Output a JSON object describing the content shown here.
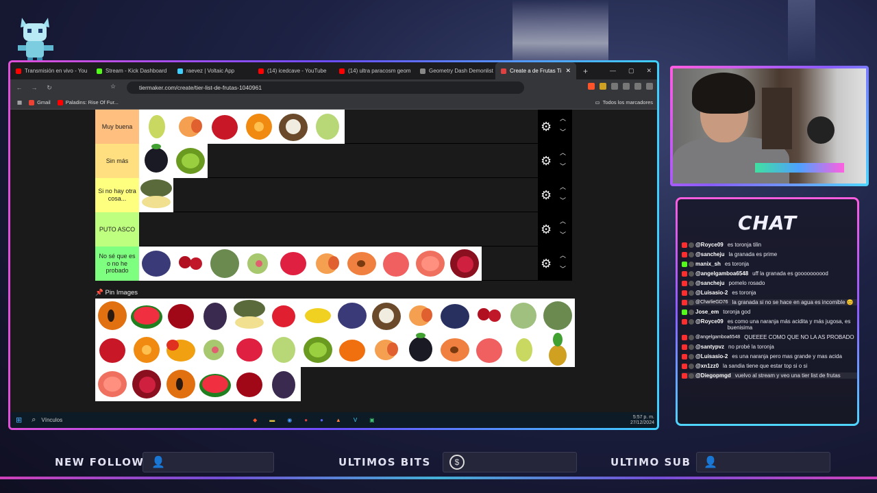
{
  "browser": {
    "tabs": [
      {
        "label": "Transmisión en vivo - You",
        "color": "#ff0000"
      },
      {
        "label": "Stream - Kick Dashboard",
        "color": "#53fc18"
      },
      {
        "label": "raevez | Voltaic App",
        "color": "#3fd0ff"
      },
      {
        "label": "(14) icedcave - YouTube",
        "color": "#ff0000"
      },
      {
        "label": "(14) ultra paracosm geom",
        "color": "#ff0000"
      },
      {
        "label": "Geometry Dash Demonlist",
        "color": "#888888"
      },
      {
        "label": "Create a de Frutas Ti",
        "color": "#e04040",
        "active": true
      }
    ],
    "new_tab": "+",
    "window_controls": [
      "—",
      "▢",
      "✕"
    ],
    "url": "tiermaker.com/create/tier-list-de-frutas-1040961",
    "bookmarks": {
      "gmail": "Gmail",
      "paladins": "Paladins: Rise Of Fur...",
      "all": "Todos los marcadores"
    }
  },
  "tierlist": {
    "tiers": [
      {
        "label": "Muy buena",
        "color": "#ffbf7f",
        "items": [
          "pear",
          "peach",
          "apple",
          "orange",
          "coconut",
          "grapes"
        ]
      },
      {
        "label": "Sin más",
        "color": "#ffdf7f",
        "items": [
          "blackberry",
          "kiwi"
        ]
      },
      {
        "label": "Si no hay otra cosa...",
        "color": "#ffff7f",
        "items": [
          "melon"
        ]
      },
      {
        "label": "PUTO ASCO",
        "color": "#bfff7f",
        "items": []
      },
      {
        "label": "No sé que es o no he probado",
        "color": "#7fff7f",
        "items": [
          "plum",
          "cherry",
          "feijoa",
          "fig",
          "raspberry",
          "peach",
          "apricot",
          "nectarine",
          "grapefruit",
          "pomegranate"
        ]
      }
    ],
    "pin_label": "Pin Images",
    "pool": [
      "papaya",
      "watermelon",
      "redapple",
      "blackgrape",
      "melon",
      "strawberry",
      "banana",
      "plum",
      "coconut",
      "peach",
      "blueberry",
      "cherry",
      "custard",
      "feijoa",
      "apple",
      "orange",
      "mango",
      "fig",
      "raspberry",
      "grapes",
      "kiwi",
      "tangerine",
      "peach",
      "blackberry",
      "apricot",
      "nectarine",
      "pear",
      "pineapple",
      "grapefruit",
      "pomegranate",
      "papaya",
      "watermelon",
      "redapple",
      "blackgrape"
    ]
  },
  "taskbar": {
    "search": "Vínculos",
    "time": "5:57 p. m.",
    "date": "27/12/2024"
  },
  "chat": {
    "title": "CHAT",
    "messages": [
      {
        "user": "@Royce09",
        "text": "es toronja tilin",
        "icon": "#ff2d2d"
      },
      {
        "user": "@sancheju",
        "text": "la granada es prime",
        "icon": "#ff2d2d"
      },
      {
        "user": "manix_sh",
        "text": "es toronja",
        "icon": "#53fc18"
      },
      {
        "user": "@angelgamboa6548",
        "text": "uff la granada es goooooooood",
        "icon": "#ff2d2d"
      },
      {
        "user": "@sancheju",
        "text": "pomelo rosado",
        "icon": "#ff2d2d"
      },
      {
        "user": "@Luisasio-2",
        "text": "es toronja",
        "icon": "#ff2d2d"
      },
      {
        "user": "@CharlieGD76",
        "text": "la granada si no se hace en agua es incomible 😊",
        "icon": "#ff2d2d",
        "small": true,
        "hl": true
      },
      {
        "user": "Jose_em",
        "text": "toronja god",
        "icon": "#53fc18"
      },
      {
        "user": "@Royce09",
        "text": "es como una naranja más acidita y más jugosa, es buenisima",
        "icon": "#ff2d2d"
      },
      {
        "user": "@angelgamboa6548",
        "text": "QUEEEE COMO QUE NO LA AS PROBADO",
        "icon": "#ff2d2d",
        "small": true
      },
      {
        "user": "@santypvz",
        "text": "no probé la toronja",
        "icon": "#ff2d2d"
      },
      {
        "user": "@Luisasio-2",
        "text": "es una naranja pero mas grande y mas acida",
        "icon": "#ff2d2d"
      },
      {
        "user": "@xn1zz0",
        "text": "la sandia tiene que estar top si o si",
        "icon": "#ff2d2d"
      },
      {
        "user": "@Diegopmgd",
        "text": "vuelvo al stream y veo una tier list de frutas",
        "icon": "#ff2d2d",
        "hl": true
      }
    ]
  },
  "overlay": {
    "follow": "NEW FOLLOW",
    "bits": "ULTIMOS BITS",
    "sub": "ULTIMO SUB"
  }
}
